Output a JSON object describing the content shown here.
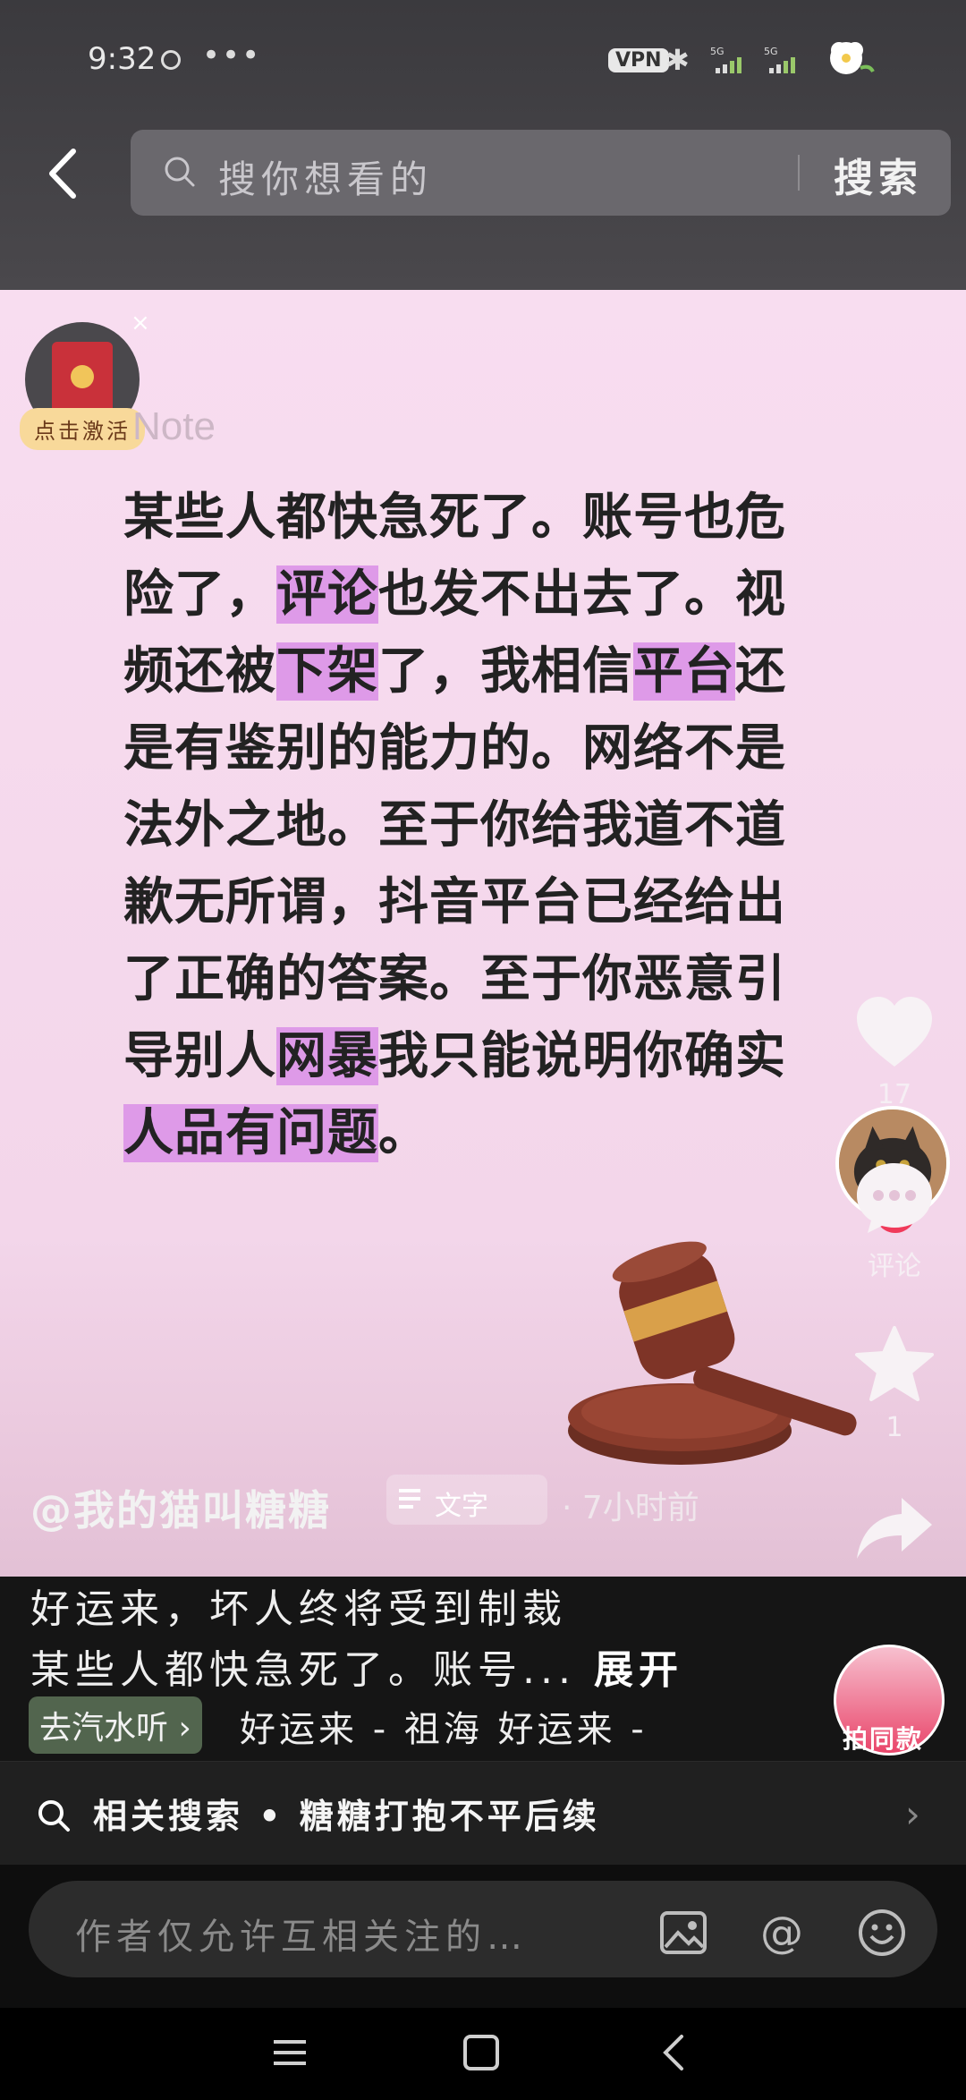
{
  "status_bar": {
    "time": "9:32",
    "more": "•••",
    "vpn": "VPN",
    "net1": "5G",
    "net2": "5G"
  },
  "search": {
    "placeholder": "搜你想看的",
    "button": "搜索"
  },
  "promo": {
    "label": "点击激活",
    "close": "×"
  },
  "watermark": "Note",
  "post": {
    "lines": [
      [
        {
          "t": "某些人都快急死了。账号也危"
        }
      ],
      [
        {
          "t": "险了，"
        },
        {
          "t": "评论",
          "hl": true
        },
        {
          "t": "也发不出去了。视"
        }
      ],
      [
        {
          "t": "频还被"
        },
        {
          "t": "下架",
          "hl": true
        },
        {
          "t": "了，我相信"
        },
        {
          "t": "平台",
          "hl": true
        },
        {
          "t": "还"
        }
      ],
      [
        {
          "t": "是有鉴别的能力的。网络不是"
        }
      ],
      [
        {
          "t": "法外之地。至于你给我道不道"
        }
      ],
      [
        {
          "t": "歉无所谓，抖音平台已经给出"
        }
      ],
      [
        {
          "t": "了正确的答案。至于你恶意引"
        }
      ],
      [
        {
          "t": "导别人"
        },
        {
          "t": "网暴",
          "hl": true
        },
        {
          "t": "我只能说明你确实"
        }
      ],
      [
        {
          "t": "人品有问题",
          "hl": true
        },
        {
          "t": "。"
        }
      ]
    ]
  },
  "actions": {
    "follow": "+",
    "like_count": "17",
    "comment_label": "评论",
    "favorite_count": "1",
    "share_label": "分享"
  },
  "author": {
    "name": "@我的猫叫糖糖",
    "tag": "文字",
    "time": "· 7小时前"
  },
  "description": {
    "line1": "好运来，坏人终将受到制裁",
    "line2": "某些人都快急死了。账号...",
    "expand": "展开"
  },
  "music": {
    "button": "去汽水听 ›",
    "track": "好运来 - 祖海    好运来 -"
  },
  "same_style": "拍同款",
  "related": {
    "text": "相关搜索 • 糖糖打抱不平后续",
    "chevron": "›"
  },
  "comment": {
    "placeholder": "作者仅允许互相关注的…"
  },
  "colors": {
    "highlight": "#de9ae8",
    "card_bg": "#f8ddf0",
    "follow_red": "#f03a5a"
  }
}
